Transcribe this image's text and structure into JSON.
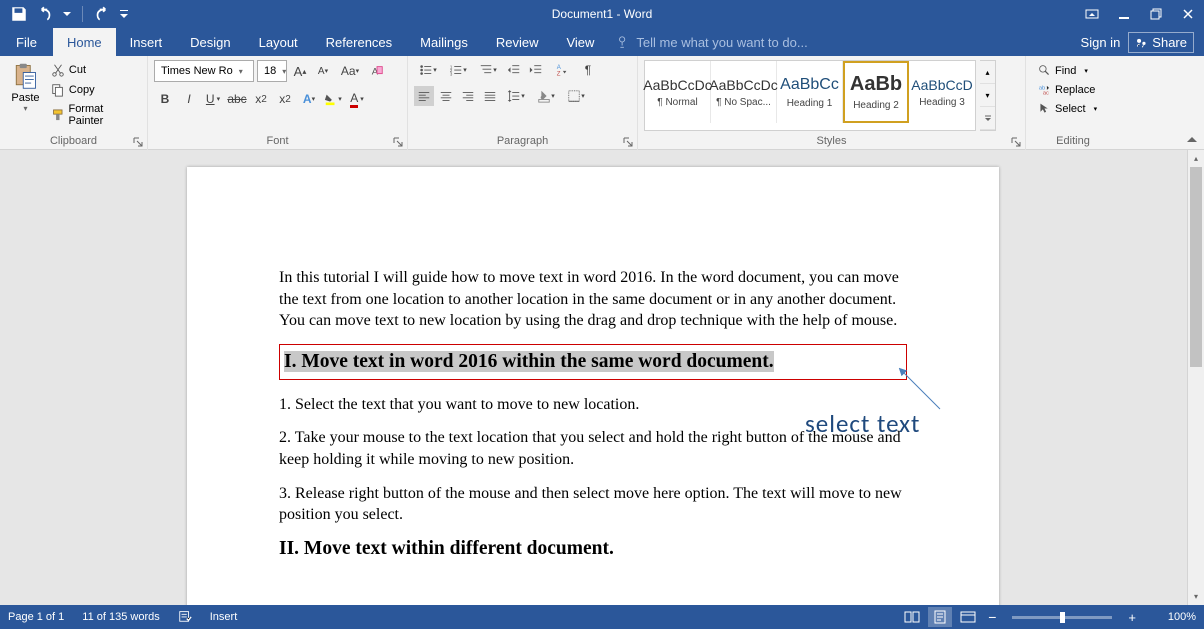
{
  "titlebar": {
    "title": "Document1 - Word"
  },
  "tabs": {
    "file": "File",
    "home": "Home",
    "insert": "Insert",
    "design": "Design",
    "layout": "Layout",
    "references": "References",
    "mailings": "Mailings",
    "review": "Review",
    "view": "View",
    "tell_me": "Tell me what you want to do...",
    "sign_in": "Sign in",
    "share": "Share"
  },
  "clipboard": {
    "paste": "Paste",
    "cut": "Cut",
    "copy": "Copy",
    "format_painter": "Format Painter",
    "group_label": "Clipboard"
  },
  "font": {
    "name": "Times New Ro",
    "size": "18",
    "group_label": "Font"
  },
  "paragraph": {
    "group_label": "Paragraph"
  },
  "styles": {
    "items": [
      {
        "preview": "AaBbCcDc",
        "name": "¶ Normal"
      },
      {
        "preview": "AaBbCcDc",
        "name": "¶ No Spac..."
      },
      {
        "preview": "AaBbCc",
        "name": "Heading 1"
      },
      {
        "preview": "AaBb",
        "name": "Heading 2"
      },
      {
        "preview": "AaBbCcD",
        "name": "Heading 3"
      }
    ],
    "group_label": "Styles"
  },
  "editing": {
    "find": "Find",
    "replace": "Replace",
    "select": "Select",
    "group_label": "Editing"
  },
  "document": {
    "p1": "In this tutorial I will guide how to move text in word 2016. In the word document, you can move the text from one location to another location in the same document or in any another document. You can move text to new location by using the drag and drop technique with the help of mouse.",
    "h1": "I. Move text in word 2016 within the same word document.",
    "p2": "1. Select the text that you want to move to new location.",
    "p3": "2. Take your mouse to the text location that you select and hold the right button of the mouse and keep holding it while moving to new position.",
    "p4": "3. Release right button of the mouse and then select move here option. The text will move to new position you select.",
    "h2": "II. Move text within different document.",
    "annotation": "select text"
  },
  "statusbar": {
    "page": "Page 1 of 1",
    "words": "11 of 135 words",
    "insert": "Insert",
    "zoom": "100%",
    "zoom_minus": "−",
    "zoom_plus": "+"
  }
}
